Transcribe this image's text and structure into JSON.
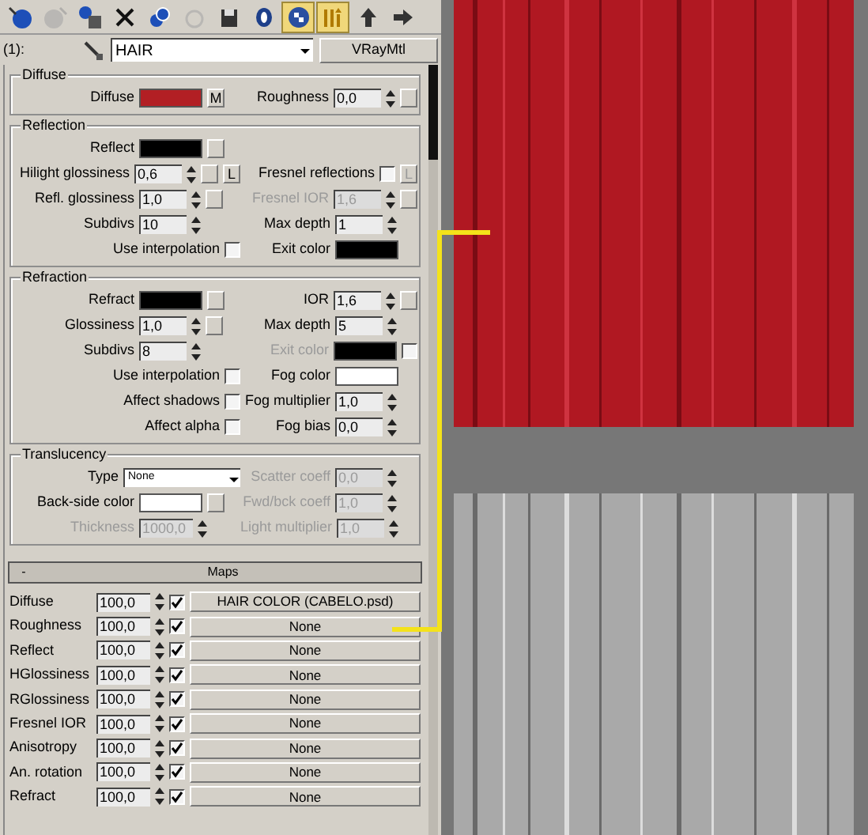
{
  "toolbar": [
    {
      "kind": "get",
      "selected": false,
      "disabled": false
    },
    {
      "kind": "put",
      "selected": false,
      "disabled": true
    },
    {
      "kind": "assign",
      "selected": false,
      "disabled": false
    },
    {
      "kind": "reset",
      "selected": false,
      "disabled": false
    },
    {
      "kind": "copy",
      "selected": false,
      "disabled": false
    },
    {
      "kind": "library",
      "selected": false,
      "disabled": true
    },
    {
      "kind": "id",
      "selected": false,
      "disabled": false
    },
    {
      "kind": "channel",
      "selected": false,
      "disabled": false
    },
    {
      "kind": "map",
      "selected": true,
      "disabled": false
    },
    {
      "kind": "result",
      "selected": true,
      "disabled": false
    },
    {
      "kind": "parent",
      "selected": false,
      "disabled": false
    },
    {
      "kind": "sibling",
      "selected": false,
      "disabled": false
    }
  ],
  "slot": "(1):",
  "material": {
    "name": "HAIR",
    "type": "VRayMtl"
  },
  "sections": [
    {
      "title": "Diffuse",
      "rows": [
        {
          "left": {
            "kind": "color",
            "label": "Diffuse",
            "color": "#b21f24",
            "extras": [
              {
                "kind": "button",
                "label": "M"
              }
            ]
          },
          "right": {
            "kind": "spinner",
            "label": "Roughness",
            "value": "0,0",
            "extras": [
              {
                "kind": "button"
              }
            ]
          }
        }
      ]
    },
    {
      "title": "Reflection",
      "rows": [
        {
          "left": {
            "kind": "color",
            "label": "Reflect",
            "color": "#000000",
            "extras": [
              {
                "kind": "button"
              }
            ]
          }
        },
        {
          "left": {
            "kind": "spinner",
            "label": "Hilight glossiness",
            "value": "0,6",
            "extras": [
              {
                "kind": "button"
              },
              {
                "kind": "button",
                "label": "L"
              }
            ]
          },
          "right": {
            "kind": "check",
            "label": "Fresnel reflections",
            "checked": false,
            "extras": [
              {
                "kind": "button",
                "label": "L",
                "disabled": true
              }
            ]
          }
        },
        {
          "left": {
            "kind": "spinner",
            "label": "Refl. glossiness",
            "value": "1,0",
            "extras": [
              {
                "kind": "button"
              }
            ]
          },
          "right": {
            "kind": "spinner",
            "label": "Fresnel IOR",
            "value": "1,6",
            "disabled": true,
            "extras": [
              {
                "kind": "button"
              }
            ]
          }
        },
        {
          "left": {
            "kind": "spinner",
            "label": "Subdivs",
            "value": "10"
          },
          "right": {
            "kind": "spinner",
            "label": "Max depth",
            "value": "1"
          }
        },
        {
          "left": {
            "kind": "check",
            "label": "Use interpolation",
            "checked": false
          },
          "right": {
            "kind": "color",
            "label": "Exit color",
            "color": "#000000"
          }
        }
      ]
    },
    {
      "title": "Refraction",
      "rows": [
        {
          "left": {
            "kind": "color",
            "label": "Refract",
            "color": "#000000",
            "extras": [
              {
                "kind": "button"
              }
            ]
          },
          "right": {
            "kind": "spinner",
            "label": "IOR",
            "value": "1,6",
            "extras": [
              {
                "kind": "button"
              }
            ]
          }
        },
        {
          "left": {
            "kind": "spinner",
            "label": "Glossiness",
            "value": "1,0",
            "extras": [
              {
                "kind": "button"
              }
            ]
          },
          "right": {
            "kind": "spinner",
            "label": "Max depth",
            "value": "5"
          }
        },
        {
          "left": {
            "kind": "spinner",
            "label": "Subdivs",
            "value": "8"
          },
          "right": {
            "kind": "color",
            "label": "Exit color",
            "color": "#000000",
            "disabled": true,
            "extras": [
              {
                "kind": "check",
                "checked": false
              }
            ]
          }
        },
        {
          "left": {
            "kind": "check",
            "label": "Use interpolation",
            "checked": false
          },
          "right": {
            "kind": "color",
            "label": "Fog color",
            "color": "#ffffff"
          }
        },
        {
          "left": {
            "kind": "check",
            "label": "Affect shadows",
            "checked": false
          },
          "right": {
            "kind": "spinner",
            "label": "Fog multiplier",
            "value": "1,0"
          }
        },
        {
          "left": {
            "kind": "check",
            "label": "Affect alpha",
            "checked": false
          },
          "right": {
            "kind": "spinner",
            "label": "Fog bias",
            "value": "0,0"
          }
        }
      ]
    },
    {
      "title": "Translucency",
      "rows": [
        {
          "left": {
            "kind": "select",
            "label": "Type",
            "value": "None"
          },
          "right": {
            "kind": "spinner",
            "label": "Scatter coeff",
            "value": "0,0",
            "disabled": true
          }
        },
        {
          "left": {
            "kind": "color",
            "label": "Back-side color",
            "color": "#ffffff",
            "extras": [
              {
                "kind": "button"
              }
            ]
          },
          "right": {
            "kind": "spinner",
            "label": "Fwd/bck coeff",
            "value": "1,0",
            "disabled": true
          }
        },
        {
          "left": {
            "kind": "spinner",
            "label": "Thickness",
            "value": "1000,0",
            "disabled": true
          },
          "right": {
            "kind": "spinner",
            "label": "Light multiplier",
            "value": "1,0",
            "disabled": true
          }
        }
      ]
    }
  ],
  "maps": {
    "toggle": "-",
    "title": "Maps",
    "rows": [
      {
        "label": "Diffuse",
        "amount": "100,0",
        "checked": true,
        "map": "HAIR COLOR (CABELO.psd)"
      },
      {
        "label": "Roughness",
        "amount": "100,0",
        "checked": true,
        "map": "None"
      },
      {
        "label": "Reflect",
        "amount": "100,0",
        "checked": true,
        "map": "None"
      },
      {
        "label": "HGlossiness",
        "amount": "100,0",
        "checked": true,
        "map": "None"
      },
      {
        "label": "RGlossiness",
        "amount": "100,0",
        "checked": true,
        "map": "None"
      },
      {
        "label": "Fresnel IOR",
        "amount": "100,0",
        "checked": true,
        "map": "None"
      },
      {
        "label": "Anisotropy",
        "amount": "100,0",
        "checked": true,
        "map": "None"
      },
      {
        "label": "An. rotation",
        "amount": "100,0",
        "checked": true,
        "map": "None"
      },
      {
        "label": "Refract",
        "amount": "100,0",
        "checked": true,
        "map": "None"
      }
    ]
  }
}
